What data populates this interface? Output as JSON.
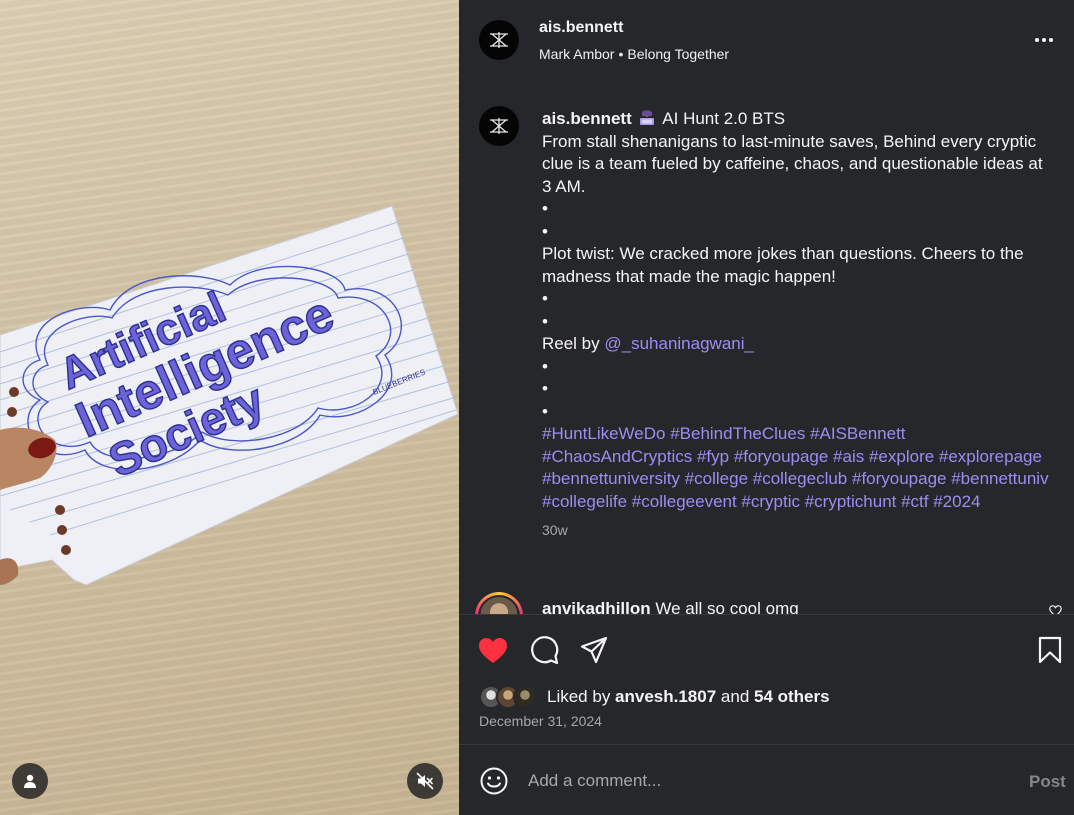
{
  "media": {
    "poster_text_lines": [
      "Artificial",
      "Intelligence",
      "Society"
    ],
    "poster_signature": "BLUEBERRIES",
    "tag_icon": "person-icon",
    "mute_icon": "speaker-muted-icon"
  },
  "header": {
    "username": "ais.bennett",
    "audio": "Mark Ambor",
    "separator": "•",
    "audio_track": "Belong Together",
    "more_icon": "more-horizontal-icon"
  },
  "caption": {
    "username": "ais.bennett",
    "title": "AI Hunt 2.0 BTS",
    "paragraph1": "From stall shenanigans to last-minute saves, Behind every cryptic clue is a team fueled by caffeine, chaos, and questionable ideas at 3 AM.",
    "bullet": "•",
    "paragraph2": "Plot twist: We cracked more jokes than questions. Cheers to the madness that made the magic happen!",
    "reel_by_label": "Reel by ",
    "mention": "@_suhaninagwani_",
    "hashtags": "#HuntLikeWeDo #BehindTheClues #AISBennett #ChaosAndCryptics #fyp #foryoupage #ais #explore #explorepage #bennettuniversity #college #collegeclub #foryoupage #bennettuniv #collegelife #collegeevent #cryptic #cryptichunt #ctf #2024",
    "time_ago": "30w"
  },
  "comment": {
    "username": "anvikadhillon",
    "text": "We all so cool omg"
  },
  "actions": {
    "liked": true,
    "like_color": "#ff3040",
    "link_color": "#9d8cf3"
  },
  "likes": {
    "prefix": "Liked by ",
    "user": "anvesh.1807",
    "middle": " and ",
    "others": "54 others"
  },
  "date": "December 31, 2024",
  "add_comment": {
    "placeholder": "Add a comment...",
    "post_label": "Post"
  }
}
